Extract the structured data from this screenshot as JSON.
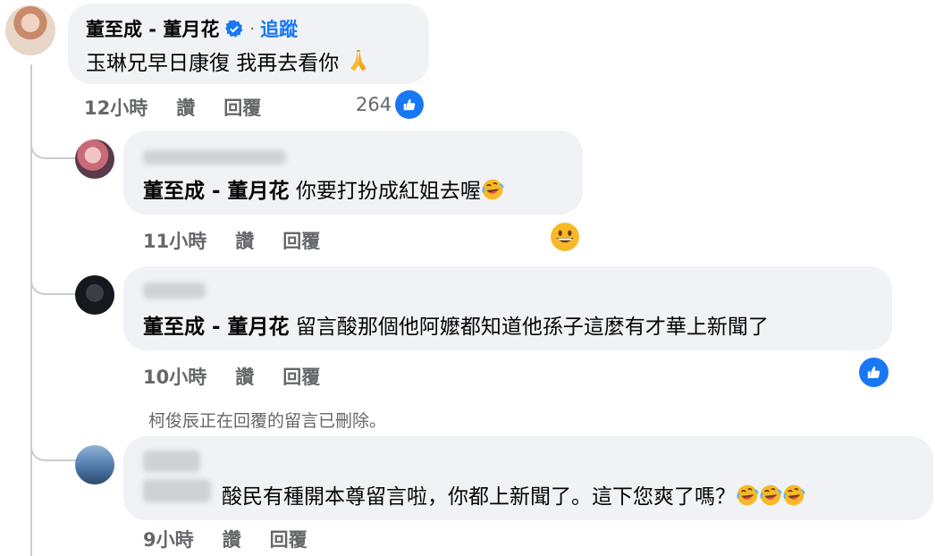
{
  "comment1": {
    "author": "董至成 - 董月花",
    "verified_icon": "verified-badge-icon",
    "dot": "·",
    "follow_label": "追蹤",
    "text": "玉琳兄早日康復 我再去看你",
    "emoji": "folded-hands",
    "time": "12小時",
    "like_label": "讚",
    "reply_label": "回覆",
    "reaction_count": "264",
    "reaction_icon": "like-icon"
  },
  "reply1": {
    "mention": "董至成 - 董月花",
    "text": "你要打扮成紅姐去喔",
    "emoji": "rolling-laughing",
    "time": "11小時",
    "like_label": "讚",
    "reply_label": "回覆",
    "reaction_icon": "grinning-face"
  },
  "reply2": {
    "mention": "董至成 - 董月花",
    "text": "留言酸那個他阿嬤都知道他孫子這麼有才華上新聞了",
    "time": "10小時",
    "like_label": "讚",
    "reply_label": "回覆",
    "reaction_icon": "like-icon"
  },
  "deleted_notice": "柯俊辰正在回覆的留言已刪除。",
  "reply3": {
    "text": "酸民有種開本尊留言啦，你都上新聞了。這下您爽了嗎？",
    "emoji": "rolling-laughing x3",
    "time": "9小時",
    "like_label": "讚",
    "reply_label": "回覆"
  },
  "colors": {
    "bubble": "#f0f2f5",
    "meta": "#65676b",
    "accent": "#1877f2",
    "thread_line": "#c9ccd1"
  }
}
